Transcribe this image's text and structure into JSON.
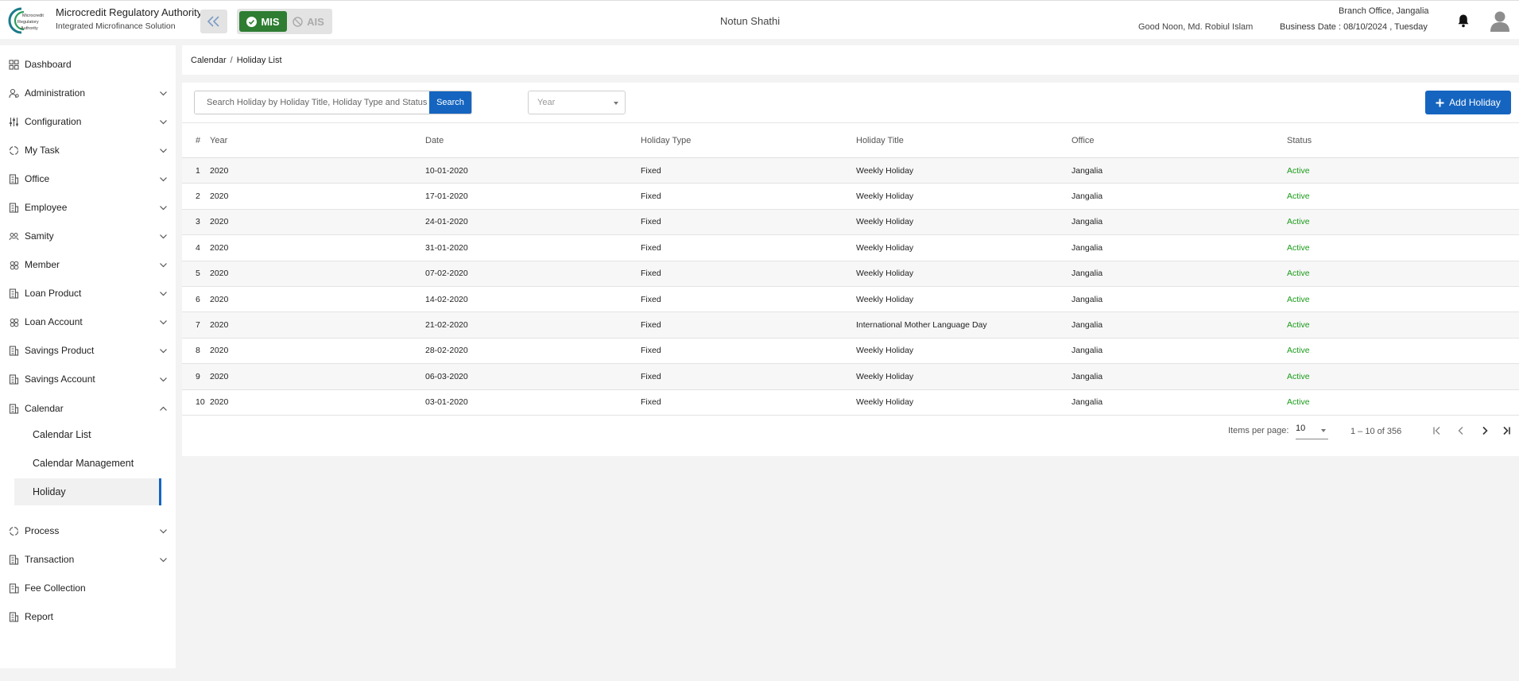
{
  "header": {
    "org_logo_text": [
      "Microcredit",
      "Regulatory",
      "Authority"
    ],
    "org_title": "Microcredit Regulatory Authority",
    "org_subtitle": "Integrated Microfinance Solution",
    "mode_mis": "MIS",
    "mode_ais": "AIS",
    "app_name": "Notun Shathi",
    "greeting": "Good Noon, Md. Robiul Islam",
    "branch": "Branch Office, Jangalia",
    "business_date": "Business Date : 08/10/2024 , Tuesday"
  },
  "sidebar": {
    "items": [
      {
        "label": "Dashboard",
        "icon": "dashboard-icon",
        "chevron": false
      },
      {
        "label": "Administration",
        "icon": "admin-icon",
        "chevron": true
      },
      {
        "label": "Configuration",
        "icon": "sliders-icon",
        "chevron": true
      },
      {
        "label": "My Task",
        "icon": "task-icon",
        "chevron": true
      },
      {
        "label": "Office",
        "icon": "office-icon",
        "chevron": true
      },
      {
        "label": "Employee",
        "icon": "employee-icon",
        "chevron": true
      },
      {
        "label": "Samity",
        "icon": "samity-icon",
        "chevron": true
      },
      {
        "label": "Member",
        "icon": "member-icon",
        "chevron": true
      },
      {
        "label": "Loan Product",
        "icon": "loan-product-icon",
        "chevron": true
      },
      {
        "label": "Loan Account",
        "icon": "loan-account-icon",
        "chevron": true
      },
      {
        "label": "Savings Product",
        "icon": "savings-product-icon",
        "chevron": true
      },
      {
        "label": "Savings Account",
        "icon": "savings-account-icon",
        "chevron": true
      },
      {
        "label": "Calendar",
        "icon": "calendar-icon",
        "chevron": true,
        "expanded": true
      }
    ],
    "calendar_sub": [
      "Calendar List",
      "Calendar Management",
      "Holiday"
    ],
    "items_after": [
      {
        "label": "Process",
        "icon": "process-icon",
        "chevron": true
      },
      {
        "label": "Transaction",
        "icon": "transaction-icon",
        "chevron": true
      },
      {
        "label": "Fee Collection",
        "icon": "fee-icon",
        "chevron": false
      },
      {
        "label": "Report",
        "icon": "report-icon",
        "chevron": false
      }
    ]
  },
  "breadcrumb": {
    "parent": "Calendar",
    "separator": "/",
    "current": "Holiday List"
  },
  "search": {
    "placeholder": "Search Holiday by Holiday Title, Holiday Type and Status",
    "button": "Search"
  },
  "year_select": {
    "placeholder": "Year"
  },
  "add_button": "Add Holiday",
  "table": {
    "columns": [
      "#",
      "Year",
      "Date",
      "Holiday Type",
      "Holiday Title",
      "Office",
      "Status"
    ],
    "rows": [
      [
        "1",
        "2020",
        "10-01-2020",
        "Fixed",
        "Weekly Holiday",
        "Jangalia",
        "Active"
      ],
      [
        "2",
        "2020",
        "17-01-2020",
        "Fixed",
        "Weekly Holiday",
        "Jangalia",
        "Active"
      ],
      [
        "3",
        "2020",
        "24-01-2020",
        "Fixed",
        "Weekly Holiday",
        "Jangalia",
        "Active"
      ],
      [
        "4",
        "2020",
        "31-01-2020",
        "Fixed",
        "Weekly Holiday",
        "Jangalia",
        "Active"
      ],
      [
        "5",
        "2020",
        "07-02-2020",
        "Fixed",
        "Weekly Holiday",
        "Jangalia",
        "Active"
      ],
      [
        "6",
        "2020",
        "14-02-2020",
        "Fixed",
        "Weekly Holiday",
        "Jangalia",
        "Active"
      ],
      [
        "7",
        "2020",
        "21-02-2020",
        "Fixed",
        "International Mother Language Day",
        "Jangalia",
        "Active"
      ],
      [
        "8",
        "2020",
        "28-02-2020",
        "Fixed",
        "Weekly Holiday",
        "Jangalia",
        "Active"
      ],
      [
        "9",
        "2020",
        "06-03-2020",
        "Fixed",
        "Weekly Holiday",
        "Jangalia",
        "Active"
      ],
      [
        "10",
        "2020",
        "03-01-2020",
        "Fixed",
        "Weekly Holiday",
        "Jangalia",
        "Active"
      ]
    ]
  },
  "pagination": {
    "items_per_page_label": "Items per page:",
    "items_per_page": "10",
    "range": "1 – 10 of 356"
  },
  "colors": {
    "primary": "#1565c0",
    "mis_green": "#2e7d32",
    "status_active": "#1a9b1a"
  }
}
